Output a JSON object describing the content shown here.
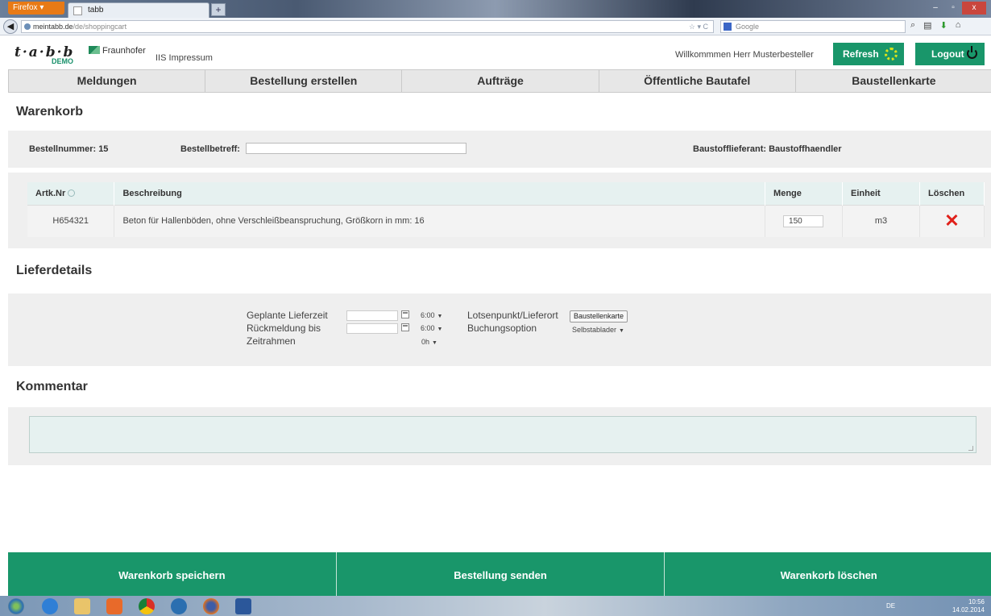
{
  "browser": {
    "menu_label": "Firefox",
    "tab_title": "tabb",
    "new_tab": "+",
    "url_host": "meintabb.de",
    "url_path": "/de/shoppingcart",
    "search_placeholder": "Google",
    "window_controls": [
      "–",
      "▫",
      "x"
    ]
  },
  "header": {
    "logo_text": "t·a·b·b",
    "logo_badge": "DEMO",
    "partner": "Fraunhofer",
    "partner_sub": "IIS",
    "impressum": "Impressum",
    "welcome": "Willkommmen Herr Musterbesteller",
    "refresh_label": "Refresh",
    "logout_label": "Logout"
  },
  "nav": {
    "items": [
      "Meldungen",
      "Bestellung erstellen",
      "Aufträge",
      "Öffentliche Bautafel",
      "Baustellenkarte"
    ]
  },
  "cart": {
    "title": "Warenkorb",
    "order_number_label": "Bestellnummer: 15",
    "subject_label": "Bestellbetreff:",
    "subject_value": "",
    "supplier_label": "Baustofflieferant: Baustoffhaendler",
    "columns": {
      "artnr": "Artk.Nr",
      "description": "Beschreibung",
      "quantity": "Menge",
      "unit": "Einheit",
      "delete": "Löschen"
    },
    "rows": [
      {
        "artnr": "H654321",
        "description": "Beton für Hallenböden, ohne Verschleißbeanspruchung, Größkorn in mm: 16",
        "quantity": "150",
        "unit": "m3",
        "delete_symbol": "✕"
      }
    ]
  },
  "delivery": {
    "title": "Lieferdetails",
    "planned_label": "Geplante Lieferzeit",
    "planned_time": "6:00",
    "response_label": "Rückmeldung bis",
    "response_time": "6:00",
    "timeframe_label": "Zeitrahmen",
    "timeframe_value": "0h",
    "location_label": "Lotsenpunkt/Lieferort",
    "location_button": "Baustellenkarte",
    "booking_label": "Buchungsoption",
    "booking_value": "Selbstablader"
  },
  "comment": {
    "title": "Kommentar",
    "value": ""
  },
  "actions": {
    "save": "Warenkorb speichern",
    "send": "Bestellung senden",
    "clear": "Warenkorb löschen"
  },
  "taskbar": {
    "lang": "DE",
    "time": "10:56",
    "date": "14.02.2014"
  },
  "colors": {
    "brand_green": "#19966a",
    "delete_red": "#e0201a",
    "panel_gray": "#efefef",
    "table_header": "#e6f1f0"
  }
}
